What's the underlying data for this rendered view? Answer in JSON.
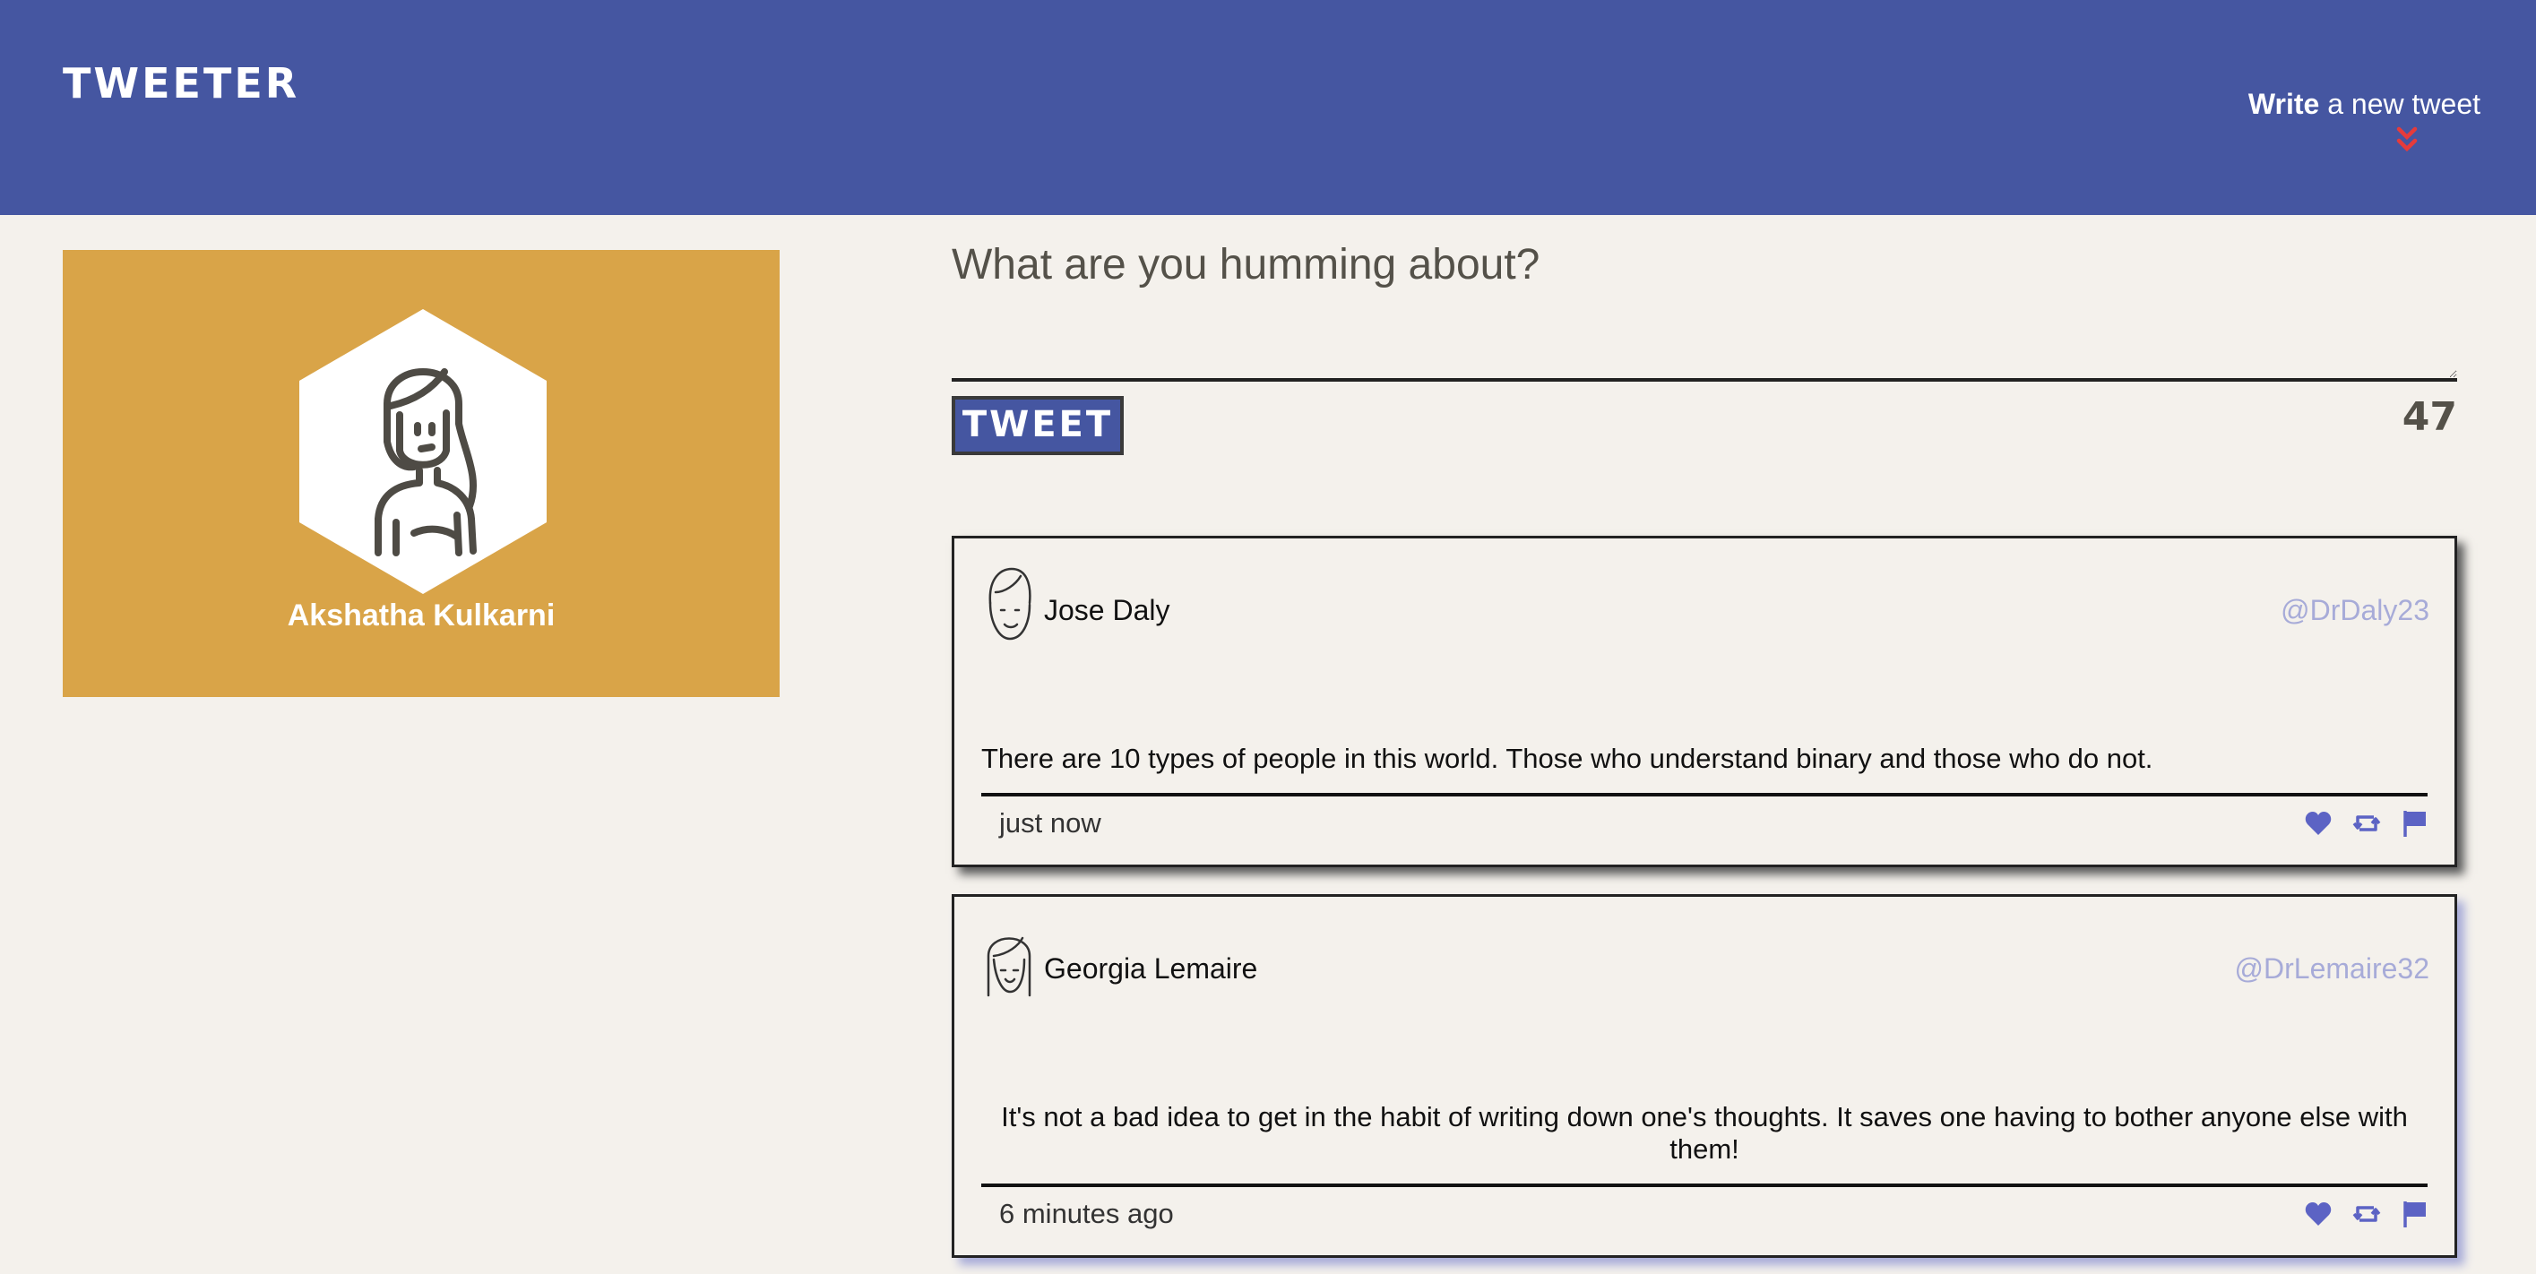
{
  "header": {
    "brand": "TWEETER",
    "toggle_bold": "Write",
    "toggle_rest": " a new tweet"
  },
  "profile": {
    "name": "Akshatha Kulkarni"
  },
  "composer": {
    "placeholder": "What are you humming about?",
    "button_label": "TWEET",
    "counter": "47"
  },
  "tweets": [
    {
      "name": "Jose Daly",
      "handle": "@DrDaly23",
      "text": "There are 10 types of people in this world. Those who understand binary and those who do not.",
      "time": "just now"
    },
    {
      "name": "Georgia Lemaire",
      "handle": "@DrLemaire32",
      "text": "It's not a bad idea to get in the habit of writing down one's thoughts. It saves one having to bother anyone else with them!",
      "time": "6 minutes ago"
    }
  ],
  "colors": {
    "nav": "#4556a1",
    "page": "#f4f1ec",
    "profile_card": "#d9a448",
    "handle": "#a7abd8",
    "action_icon": "#5c63c4",
    "chevron": "#e53b3b"
  },
  "icons": [
    "chevron-down-icon",
    "female-avatar-icon",
    "male-avatar-icon",
    "heart-icon",
    "retweet-icon",
    "flag-icon"
  ]
}
